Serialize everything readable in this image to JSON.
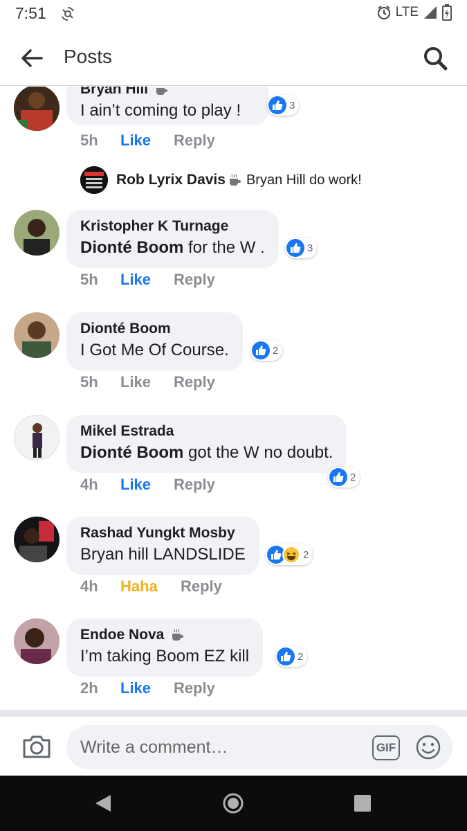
{
  "status_bar": {
    "time": "7:51",
    "network": "LTE"
  },
  "app_bar": {
    "title": "Posts"
  },
  "comments": [
    {
      "name": "Bryan Hill",
      "text": "I ain’t coming to play !",
      "reactions": "3",
      "time": "5h",
      "like_label": "Like",
      "reply_label": "Reply",
      "reply": {
        "name": "Rob Lyrix Davis",
        "text": "Bryan Hill do work!"
      }
    },
    {
      "name": "Kristopher K Turnage",
      "mention": "Dionté Boom",
      "text": " for the W .",
      "reactions": "3",
      "time": "5h",
      "like_label": "Like",
      "reply_label": "Reply"
    },
    {
      "name": "Dionté Boom",
      "text": "I Got Me Of Course.",
      "reactions": "2",
      "time": "5h",
      "like_label": "Like",
      "reply_label": "Reply"
    },
    {
      "name": "Mikel Estrada",
      "mention": "Dionté Boom",
      "text": " got the W no doubt.",
      "reactions": "2",
      "time": "4h",
      "like_label": "Like",
      "reply_label": "Reply"
    },
    {
      "name": "Rashad Yungkt Mosby",
      "text": "Bryan hill LANDSLIDE",
      "reactions": "2",
      "time": "4h",
      "like_label": "Haha",
      "reply_label": "Reply"
    },
    {
      "name": "Endoe Nova",
      "text": "I’m taking Boom EZ kill",
      "reactions": "2",
      "time": "2h",
      "like_label": "Like",
      "reply_label": "Reply"
    }
  ],
  "composer": {
    "placeholder": "Write a comment…",
    "gif_label": "GIF"
  },
  "colors": {
    "accent": "#1877f2",
    "haha": "#f2b01e",
    "bubble": "#f0f2f5",
    "muted": "#8a8d91"
  }
}
